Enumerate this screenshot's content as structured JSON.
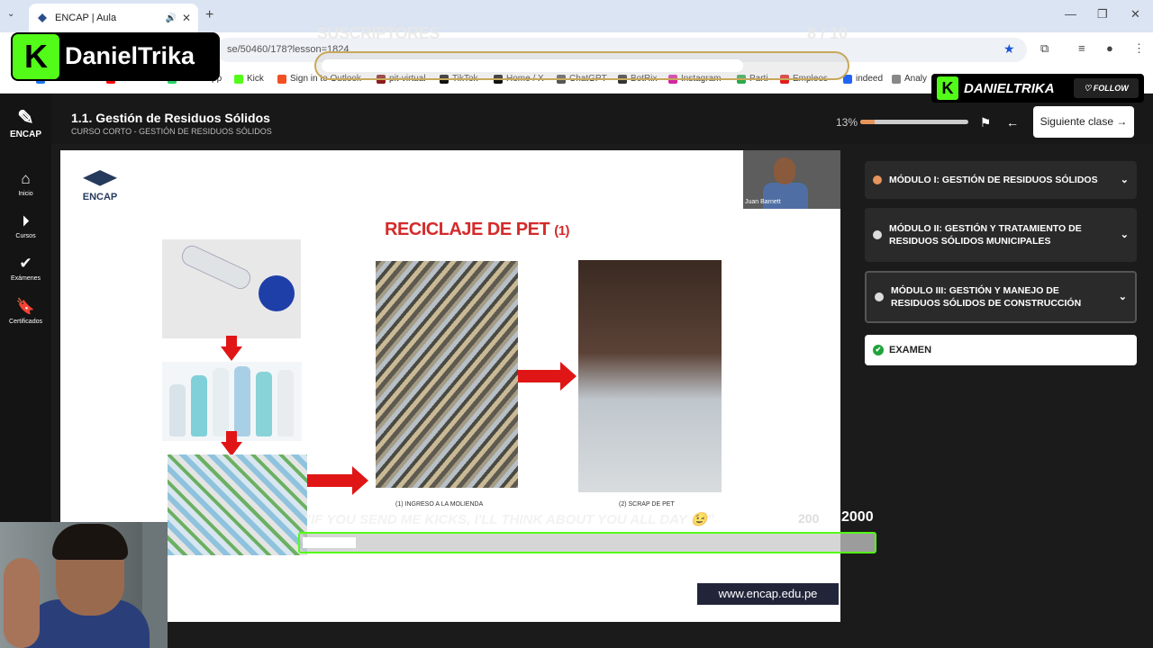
{
  "browser": {
    "tab_title": "ENCAP | Aula",
    "address": "se/50460/178?lesson=1824",
    "bookmarks": [
      "Facebook",
      "YouTube",
      "WhatsApp",
      "Kick",
      "Sign in to Outlook",
      "pit-virtual",
      "TikTok",
      "Home / X",
      "ChatGPT",
      "BotRix",
      "Instagram",
      "Parti",
      "Empleos",
      "indeed",
      "Analy"
    ]
  },
  "sidebar": {
    "logo": "ENCAP",
    "items": [
      {
        "label": "Inicio",
        "icon": "home-icon"
      },
      {
        "label": "Cursos",
        "icon": "play-circle-icon"
      },
      {
        "label": "Exámenes",
        "icon": "check-icon"
      },
      {
        "label": "Certificados",
        "icon": "bookmark-icon"
      }
    ]
  },
  "header": {
    "title": "1.1. Gestión de Residuos Sólidos",
    "subtitle": "CURSO CORTO - GESTIÓN DE RESIDUOS SÓLIDOS",
    "progress_label": "13%",
    "progress": 0.13,
    "next_label": "Siguiente clase"
  },
  "slide": {
    "logo": "ENCAP",
    "title": "RECICLAJE DE PET",
    "title_suffix": "(1)",
    "caption1": "(1) INGRESO A LA MOLIENDA",
    "caption2": "(2) SCRAP DE PET",
    "camera_name": "Juan Barnett",
    "url": "www.encap.edu.pe"
  },
  "modules": [
    {
      "label": "MÓDULO I: GESTIÓN DE RESIDUOS SÓLIDOS",
      "status": "partial"
    },
    {
      "label": "MÓDULO II: GESTIÓN Y TRATAMIENTO DE RESIDUOS SÓLIDOS MUNICIPALES",
      "status": "pending"
    },
    {
      "label": "MÓDULO III: GESTIÓN Y MANEJO DE RESIDUOS SÓLIDOS DE CONSTRUCCIÓN",
      "status": "pending"
    }
  ],
  "exam": {
    "label": "EXAMEN",
    "status": "done"
  },
  "overlay": {
    "streamer": "DanielTrika",
    "follow_name": "DANIELTRIKA",
    "follow_label": "FOLLOW",
    "subs_label": "SUSCRIPTORES",
    "subs_count": "8",
    "subs_goal": "/ 10",
    "kicks_message": "\"IF YOU SEND ME KICKS, I'LL THINK ABOUT YOU ALL DAY 😉\"",
    "kicks_count": "200",
    "kicks_goal": "/ 2000",
    "kicks_goal_strong": "2000"
  },
  "colors": {
    "kick_green": "#53fc18",
    "progress_orange": "#e5955b",
    "slide_title_red": "#d42a2a"
  }
}
